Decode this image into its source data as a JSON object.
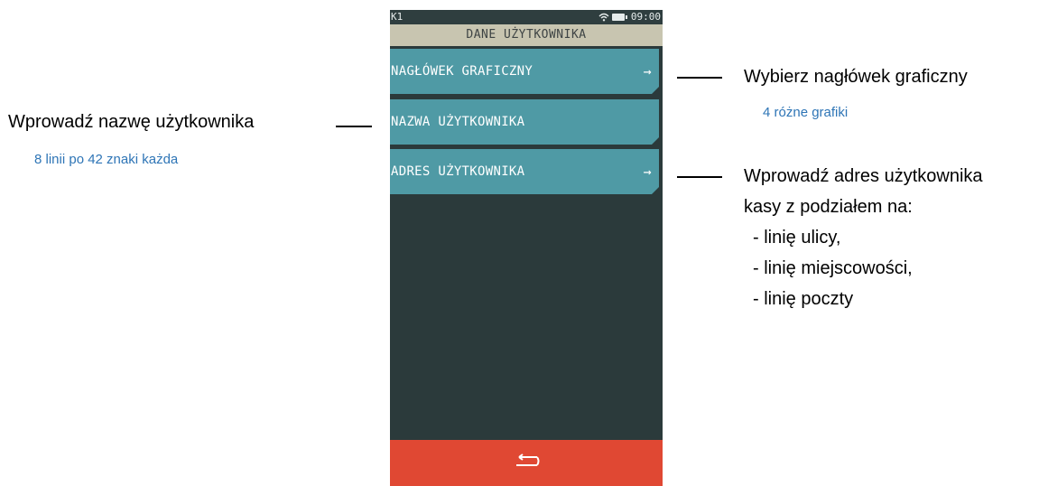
{
  "status_bar": {
    "cash_register_id": "K1",
    "time": "09:00"
  },
  "screen": {
    "title": "DANE UŻYTKOWNIKA"
  },
  "menu": {
    "items": [
      {
        "label": "NAGŁÓWEK GRAFICZNY",
        "arrow": "→"
      },
      {
        "label": "NAZWA UŻYTKOWNIKA",
        "arrow": ""
      },
      {
        "label": "ADRES UŻYTKOWNIKA",
        "arrow": "→"
      }
    ]
  },
  "annotations": {
    "left": {
      "title": "Wprowadź nazwę użytkownika",
      "note": "8 linii po 42 znaki każda"
    },
    "right_top": {
      "title": "Wybierz nagłówek graficzny",
      "note": "4 różne grafiki"
    },
    "right_bottom": {
      "line1": "Wprowadź adres użytkownika",
      "line2": "kasy z podziałem na:",
      "bullets": [
        "- linię ulicy,",
        "- linię miejscowości,",
        "- linię poczty"
      ]
    }
  },
  "colors": {
    "menu_item": "#4f9aa5",
    "title_bar": "#c8c5b0",
    "background": "#2b3a3b",
    "back_bar": "#e04833",
    "note_text": "#2e75b6"
  },
  "icons": {
    "wifi": "wifi-icon",
    "battery": "battery-icon",
    "back": "back-arrow-icon"
  }
}
